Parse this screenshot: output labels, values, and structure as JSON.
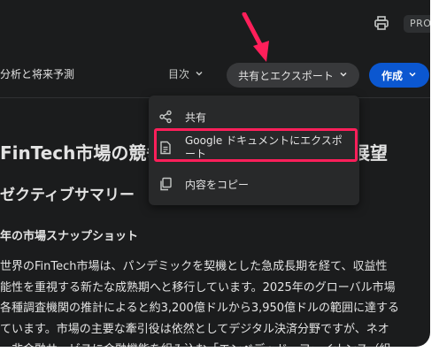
{
  "topbar": {
    "print_icon": "printer-icon",
    "pro_label": "PRO"
  },
  "toolbar": {
    "doc_title": "分析と将来予測",
    "toc_label": "目次",
    "share_export_label": "共有とエクスポート",
    "create_label": "作成"
  },
  "document": {
    "heading1_left": "FinTech市場の競争",
    "heading1_right": "展望",
    "heading2": "ゼクティブサマリー",
    "heading3": "年の市場スナップショット",
    "paragraph_lines": [
      "世界のFinTech市場は、パンデミックを契機とした急成長期を経て、収益性",
      "能性を重視する新たな成熟期へと移行しています。2025年のグローバル市場",
      "各種調査機関の推計によると約3,200億ドルから3,950億ドルの範囲に達する",
      "ています。市場の主要な牽引役は依然としてデジタル決済分野ですが、ネオ",
      "、非金融サービスに金融機能を組み込む「エンベデッド・ファイナンス（組"
    ]
  },
  "menu": {
    "items": [
      {
        "label": "共有",
        "icon": "share-icon"
      },
      {
        "label": "Google ドキュメントにエクスポート",
        "icon": "document-icon"
      },
      {
        "label": "内容をコピー",
        "icon": "copy-icon"
      }
    ]
  },
  "colors": {
    "background": "#1b1c1d",
    "menu_bg": "#28292a",
    "accent_blue": "#0b57d0",
    "highlight_red": "#ff1f5a"
  }
}
